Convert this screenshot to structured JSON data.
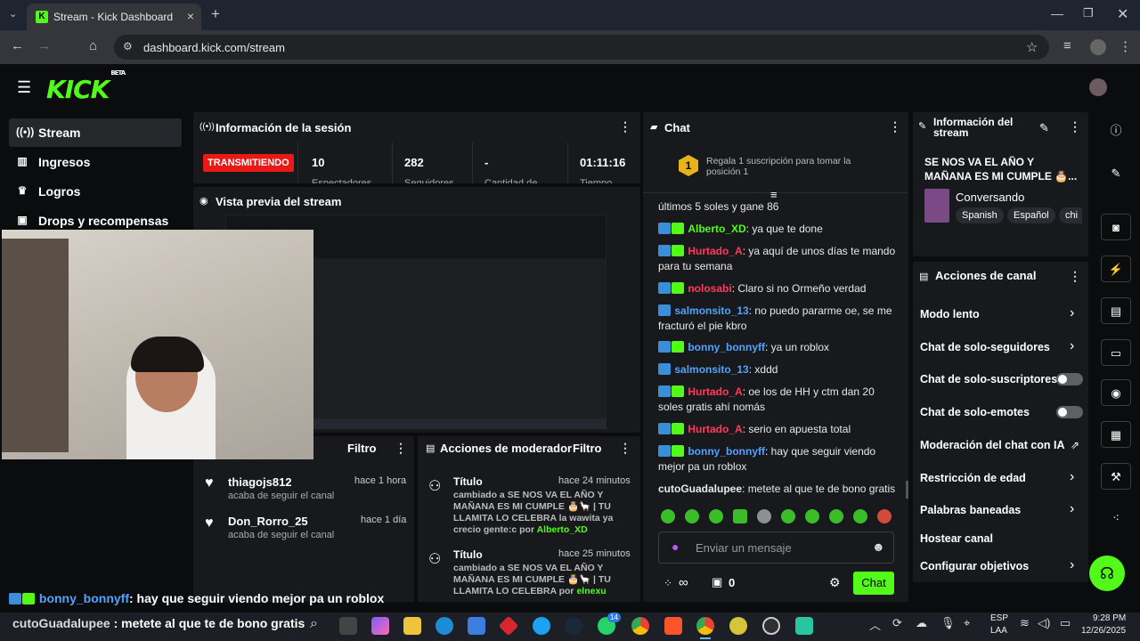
{
  "browser": {
    "tab_title": "Stream - Kick Dashboard",
    "url": "dashboard.kick.com/stream"
  },
  "app": {
    "logo": "KICK",
    "logo_badge": "BETA",
    "nav": [
      {
        "label": "Stream",
        "icon": "broadcast-icon",
        "active": true
      },
      {
        "label": "Ingresos",
        "icon": "bar-chart-icon"
      },
      {
        "label": "Logros",
        "icon": "trophy-icon"
      },
      {
        "label": "Drops y recompensas",
        "icon": "gift-icon"
      }
    ]
  },
  "session": {
    "title": "Información de la sesión",
    "live_badge": "TRANSMITIENDO",
    "stats": [
      {
        "value": "10",
        "label": "Espectadores"
      },
      {
        "value": "282",
        "label": "Seguidores"
      },
      {
        "value": "-",
        "label": "Cantidad de"
      },
      {
        "value": "01:11:16",
        "label": "Tiempo"
      }
    ]
  },
  "preview": {
    "title": "Vista previa del stream"
  },
  "activity": {
    "filter_label": "Filtro",
    "items": [
      {
        "user": "thiagojs812",
        "time": "hace 1 hora",
        "desc": "acaba de seguir el canal"
      },
      {
        "user": "Don_Rorro_25",
        "time": "hace 1 día",
        "desc": "acaba de seguir el canal"
      }
    ]
  },
  "mod_actions": {
    "title": "Acciones de moderador",
    "filter_label": "Filtro",
    "items": [
      {
        "title": "Título",
        "time": "hace 24 minutos",
        "text": "cambiado a SE NOS VA EL AÑO Y MAÑANA ES MI CUMPLE 🎂🦙 | TU LLAMITA LO CELEBRA la wawita ya crecio gente:c por",
        "by": "Alberto_XD"
      },
      {
        "title": "Título",
        "time": "hace 25 minutos",
        "text": "cambiado a SE NOS VA EL AÑO Y MAÑANA ES MI CUMPLE 🎂🦙 | TU LLAMITA LO CELEBRA por",
        "by": "elnexu"
      }
    ]
  },
  "chat": {
    "title": "Chat",
    "sub_promo": "Regala 1 suscripción para tomar la posición 1",
    "sub_position": "1",
    "messages": [
      {
        "user": "",
        "color": "#e9e9e9",
        "text": "últimos 5 soles y gane 86"
      },
      {
        "user": "Alberto_XD",
        "color": "#53fc18",
        "text": "ya que te done"
      },
      {
        "user": "Hurtado_A",
        "color": "#ff3b5c",
        "text": "ya aquí de unos días te mando para tu semana"
      },
      {
        "user": "nolosabi",
        "color": "#ff3b5c",
        "text": "Claro si no Ormeño verdad"
      },
      {
        "user": "salmonsito_13",
        "color": "#4fa3ff",
        "text": "no puedo pararme oe, se me fracturó el pie kbro"
      },
      {
        "user": "bonny_bonnyff",
        "color": "#4fa3ff",
        "text": "ya un roblox"
      },
      {
        "user": "salmonsito_13",
        "color": "#4fa3ff",
        "text": "xddd"
      },
      {
        "user": "Hurtado_A",
        "color": "#ff3b5c",
        "text": "oe los de HH y ctm dan 20 soles gratis ahí nomás"
      },
      {
        "user": "Hurtado_A",
        "color": "#ff3b5c",
        "text": "serio en apuesta total"
      },
      {
        "user": "bonny_bonnyff",
        "color": "#4fa3ff",
        "text": "hay que seguir viendo mejor pa un roblox"
      },
      {
        "user": "cutoGuadalupee",
        "color": "#e9e9e9",
        "text": "metete al que te de bono gratis"
      }
    ],
    "input_placeholder": "Enviar un mensaje",
    "points": "∞",
    "gifts": "0",
    "send_label": "Chat"
  },
  "stream_info": {
    "title": "Información del stream",
    "stream_title": "SE NOS VA EL AÑO Y MAÑANA ES MI CUMPLE 🎂...",
    "category": "Conversando",
    "tags": [
      "Spanish",
      "Español",
      "chi"
    ]
  },
  "channel_actions": {
    "title": "Acciones de canal",
    "items": [
      {
        "label": "Modo lento",
        "control": "chevron"
      },
      {
        "label": "Chat de solo-seguidores",
        "control": "chevron"
      },
      {
        "label": "Chat de solo-suscriptores",
        "control": "toggle"
      },
      {
        "label": "Chat de solo-emotes",
        "control": "toggle"
      },
      {
        "label": "Moderación del chat con IA",
        "control": "external"
      },
      {
        "label": "Restricción de edad",
        "control": "chevron"
      },
      {
        "label": "Palabras baneadas",
        "control": "chevron"
      },
      {
        "label": "Hostear canal",
        "control": "none"
      },
      {
        "label": "Configurar objetivos",
        "control": "chevron"
      }
    ]
  },
  "overlay": {
    "line1_user": "bonny_bonnyff",
    "line1_text": ": hay que seguir viendo mejor pa un roblox",
    "line2_user": "cutoGuadalupee",
    "line2_text": " : metete al que te de bono gratis"
  },
  "taskbar": {
    "lang": "ESP",
    "region": "LAA",
    "time": "9:28 PM",
    "date": "12/26/2025",
    "whatsapp_badge": "14"
  }
}
